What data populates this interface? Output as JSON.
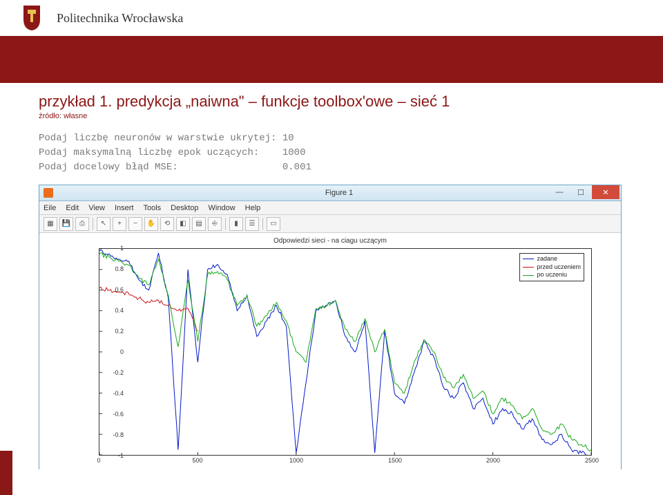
{
  "header": {
    "university": "Politechnika Wrocławska"
  },
  "slide": {
    "title": "przykład 1. predykcja „naiwna\" – funkcje toolbox'owe – sieć 1",
    "subtitle": "źródło: własne"
  },
  "console": {
    "rows": [
      {
        "label": "Podaj liczbę neuronów w warstwie ukrytej: ",
        "value": "10"
      },
      {
        "label": "Podaj maksymalną liczbę epok uczących:    ",
        "value": "1000"
      },
      {
        "label": "Podaj docelowy błąd MSE:                  ",
        "value": "0.001"
      }
    ]
  },
  "figure": {
    "window_title": "Figure 1",
    "menus": [
      "Eile",
      "Edit",
      "View",
      "Insert",
      "Tools",
      "Desktop",
      "Window",
      "Help"
    ],
    "chart_title": "Odpowiedzi sieci - na ciagu uczącym",
    "legend": [
      "zadane",
      "przed uczeniem",
      "po uczeniu"
    ],
    "yticks": [
      "1",
      "0.8",
      "0.6",
      "0.4",
      "0.2",
      "0",
      "-0.2",
      "-0.4",
      "-0.6",
      "-0.8",
      "-1"
    ],
    "xticks": [
      "0",
      "500",
      "1000",
      "1500",
      "2000",
      "2500"
    ]
  },
  "chart_data": {
    "type": "line",
    "title": "Odpowiedzi sieci - na ciagu uczącym",
    "xlabel": "",
    "ylabel": "",
    "xlim": [
      0,
      2500
    ],
    "ylim": [
      -1,
      1
    ],
    "x": [
      0,
      50,
      100,
      150,
      200,
      250,
      300,
      350,
      400,
      450,
      500,
      550,
      600,
      650,
      700,
      750,
      800,
      850,
      900,
      950,
      1000,
      1050,
      1100,
      1150,
      1200,
      1250,
      1300,
      1350,
      1400,
      1450,
      1500,
      1550,
      1600,
      1650,
      1700,
      1750,
      1800,
      1850,
      1900,
      1950,
      2000,
      2050,
      2100,
      2150,
      2200,
      2250,
      2300,
      2350,
      2400,
      2450,
      2500
    ],
    "series": [
      {
        "name": "zadane",
        "color": "#0018c8",
        "values": [
          0.98,
          0.95,
          0.9,
          0.88,
          0.7,
          0.6,
          0.96,
          0.52,
          -0.95,
          0.8,
          -0.1,
          0.8,
          0.85,
          0.75,
          0.4,
          0.55,
          0.15,
          0.3,
          0.45,
          0.25,
          -0.98,
          -0.3,
          0.4,
          0.45,
          0.5,
          0.15,
          0.0,
          0.3,
          -0.98,
          0.2,
          -0.4,
          -0.5,
          -0.2,
          0.1,
          -0.05,
          -0.35,
          -0.45,
          -0.3,
          -0.55,
          -0.45,
          -0.7,
          -0.55,
          -0.6,
          -0.75,
          -0.65,
          -0.85,
          -0.9,
          -0.8,
          -0.95,
          -0.98,
          -1.0
        ]
      },
      {
        "name": "przed uczeniem",
        "color": "#c81414",
        "values": [
          0.62,
          0.6,
          0.58,
          0.56,
          0.52,
          0.48,
          0.5,
          0.45,
          0.4,
          0.42,
          0.2
        ],
        "x": [
          0,
          50,
          100,
          150,
          200,
          250,
          300,
          350,
          400,
          450,
          500
        ]
      },
      {
        "name": "po uczeniu",
        "color": "#17a817",
        "values": [
          0.95,
          0.92,
          0.88,
          0.84,
          0.72,
          0.65,
          0.9,
          0.55,
          0.05,
          0.7,
          0.1,
          0.75,
          0.78,
          0.7,
          0.45,
          0.55,
          0.25,
          0.35,
          0.48,
          0.3,
          0.0,
          -0.1,
          0.42,
          0.44,
          0.5,
          0.22,
          0.1,
          0.32,
          0.0,
          0.22,
          -0.3,
          -0.4,
          -0.1,
          0.12,
          0.0,
          -0.25,
          -0.35,
          -0.22,
          -0.45,
          -0.38,
          -0.6,
          -0.45,
          -0.52,
          -0.65,
          -0.55,
          -0.75,
          -0.8,
          -0.7,
          -0.85,
          -0.9,
          -0.95
        ]
      }
    ],
    "legend_position": "upper right"
  }
}
